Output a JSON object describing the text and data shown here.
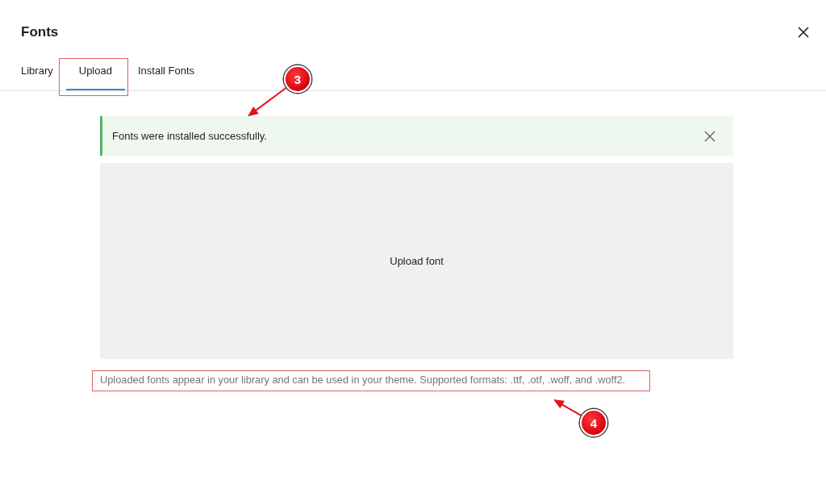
{
  "dialog": {
    "title": "Fonts"
  },
  "tabs": [
    {
      "label": "Library",
      "selected": false,
      "highlighted": false
    },
    {
      "label": "Upload",
      "selected": true,
      "highlighted": true
    },
    {
      "label": "Install Fonts",
      "selected": false,
      "highlighted": false
    }
  ],
  "notice": {
    "kind": "success",
    "text": "Fonts were installed successfully.",
    "callout": "3"
  },
  "upload": {
    "label": "Upload font"
  },
  "help": {
    "text": "Uploaded fonts appear in your library and can be used in your theme. Supported formats: .ttf, .otf, .woff, and .woff2.",
    "highlighted": true,
    "callout": "4"
  }
}
